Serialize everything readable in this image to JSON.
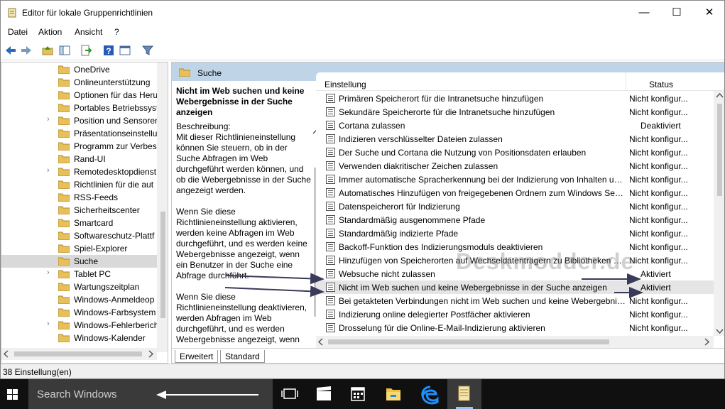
{
  "window": {
    "title": "Editor für lokale Gruppenrichtlinien",
    "minimize": "—",
    "maximize": "☐",
    "close": "✕"
  },
  "menu": [
    "Datei",
    "Aktion",
    "Ansicht",
    "?"
  ],
  "tree": {
    "items": [
      {
        "label": "OneDrive",
        "expandable": false,
        "selected": false
      },
      {
        "label": "Onlineunterstützung",
        "expandable": false,
        "selected": false
      },
      {
        "label": "Optionen für das Heru",
        "expandable": false,
        "selected": false
      },
      {
        "label": "Portables Betriebssyst",
        "expandable": false,
        "selected": false
      },
      {
        "label": "Position und Sensoren",
        "expandable": true,
        "selected": false
      },
      {
        "label": "Präsentationseinstellu",
        "expandable": false,
        "selected": false
      },
      {
        "label": "Programm zur Verbess",
        "expandable": false,
        "selected": false
      },
      {
        "label": "Rand-UI",
        "expandable": false,
        "selected": false
      },
      {
        "label": "Remotedesktopdienst",
        "expandable": true,
        "selected": false
      },
      {
        "label": "Richtlinien für die aut",
        "expandable": false,
        "selected": false
      },
      {
        "label": "RSS-Feeds",
        "expandable": false,
        "selected": false
      },
      {
        "label": "Sicherheitscenter",
        "expandable": false,
        "selected": false
      },
      {
        "label": "Smartcard",
        "expandable": false,
        "selected": false
      },
      {
        "label": "Softwareschutz-Plattf",
        "expandable": false,
        "selected": false
      },
      {
        "label": "Spiel-Explorer",
        "expandable": false,
        "selected": false
      },
      {
        "label": "Suche",
        "expandable": false,
        "selected": true
      },
      {
        "label": "Tablet PC",
        "expandable": true,
        "selected": false
      },
      {
        "label": "Wartungszeitplan",
        "expandable": false,
        "selected": false
      },
      {
        "label": "Windows-Anmeldeop",
        "expandable": false,
        "selected": false
      },
      {
        "label": "Windows-Farbsystem",
        "expandable": false,
        "selected": false
      },
      {
        "label": "Windows-Fehlerberich",
        "expandable": true,
        "selected": false
      },
      {
        "label": "Windows-Kalender",
        "expandable": false,
        "selected": false
      }
    ]
  },
  "main": {
    "header": "Suche",
    "description": {
      "title": "Nicht im Web suchen und keine Webergebnisse in der Suche anzeigen",
      "body": "Beschreibung:\nMit dieser Richtlinieneinstellung können Sie steuern, ob in der Suche Abfragen im Web durchgeführt werden können, und ob die Webergebnisse in der Suche angezeigt werden.\n\nWenn Sie diese Richtlinieneinstellung aktivieren, werden keine Abfragen im Web durchgeführt, und es werden keine Webergebnisse angezeigt, wenn ein Benutzer in der Suche eine Abfrage durchführt.\n\nWenn Sie diese Richtlinieneinstellung deaktivieren, werden Abfragen im Web durchgeführt, und es werden Webergebnisse angezeigt, wenn"
    },
    "columns": {
      "setting": "Einstellung",
      "status": "Status"
    },
    "rows": [
      {
        "name": "Primären Speicherort für die Intranetsuche hinzufügen",
        "status": "Nicht konfigur..."
      },
      {
        "name": "Sekundäre Speicherorte für die Intranetsuche hinzufügen",
        "status": "Nicht konfigur..."
      },
      {
        "name": "Cortana zulassen",
        "status": "Deaktiviert"
      },
      {
        "name": "Indizieren verschlüsselter Dateien zulassen",
        "status": "Nicht konfigur..."
      },
      {
        "name": "Der Suche und Cortana die Nutzung von Positionsdaten erlauben",
        "status": "Nicht konfigur..."
      },
      {
        "name": "Verwenden diakritischer Zeichen zulassen",
        "status": "Nicht konfigur..."
      },
      {
        "name": "Immer automatische Spracherkennung bei der Indizierung von Inhalten un...",
        "status": "Nicht konfigur..."
      },
      {
        "name": "Automatisches Hinzufügen von freigegebenen Ordnern zum Windows Sea...",
        "status": "Nicht konfigur..."
      },
      {
        "name": "Datenspeicherort für Indizierung",
        "status": "Nicht konfigur..."
      },
      {
        "name": "Standardmäßig ausgenommene Pfade",
        "status": "Nicht konfigur..."
      },
      {
        "name": "Standardmäßig indizierte Pfade",
        "status": "Nicht konfigur..."
      },
      {
        "name": "Backoff-Funktion des Indizierungsmoduls deaktivieren",
        "status": "Nicht konfigur..."
      },
      {
        "name": "Hinzufügen von Speicherorten auf Wechseldatenträgern zu Bibliotheken ni...",
        "status": "Nicht konfigur..."
      },
      {
        "name": "Websuche nicht zulassen",
        "status": "Aktiviert"
      },
      {
        "name": "Nicht im Web suchen und keine Webergebnisse in der Suche anzeigen",
        "status": "Aktiviert"
      },
      {
        "name": "Bei getakteten Verbindungen nicht im Web suchen und keine Webergebnis...",
        "status": "Nicht konfigur..."
      },
      {
        "name": "Indizierung online delegierter Postfächer aktivieren",
        "status": "Nicht konfigur..."
      },
      {
        "name": "Drosselung für die Online-E-Mail-Indizierung aktivieren",
        "status": "Nicht konfigur..."
      }
    ],
    "tabs": [
      "Erweitert",
      "Standard"
    ]
  },
  "status_bar": "38 Einstellung(en)",
  "taskbar": {
    "search_placeholder": "Search Windows",
    "icons": [
      "task-view-icon",
      "media-icon",
      "calendar-icon",
      "file-explorer-icon",
      "edge-icon",
      "notepad-icon"
    ]
  },
  "watermark": "Deskmodder.de",
  "colors": {
    "header_bg": "#c0d4e8",
    "taskbar_bg": "#101010",
    "search_bg": "#3a3a3a",
    "folder": "#e8c058",
    "selected_row": "#d9d9d9"
  }
}
